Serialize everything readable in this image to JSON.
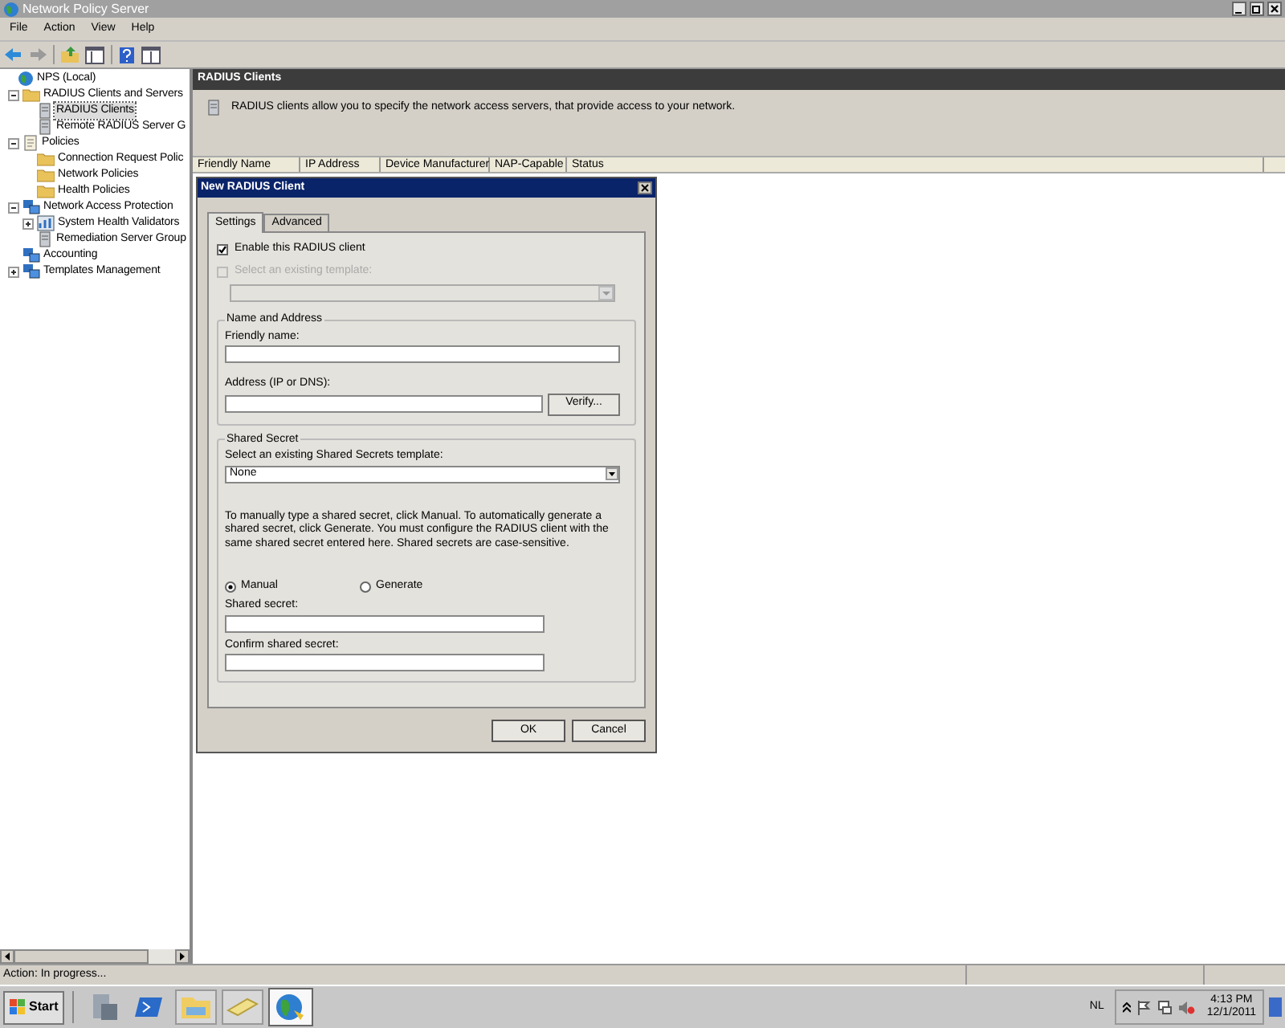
{
  "window": {
    "title": "Network Policy Server"
  },
  "menu": [
    "File",
    "Action",
    "View",
    "Help"
  ],
  "tree": [
    {
      "label": "NPS (Local)",
      "kind": "globe",
      "selected": false,
      "children": [
        {
          "label": "RADIUS Clients and Servers",
          "kind": "folder",
          "selected": false,
          "expanded": true,
          "children": [
            {
              "label": "RADIUS Clients",
              "kind": "server",
              "selected": true
            },
            {
              "label": "Remote RADIUS Server G",
              "kind": "server",
              "selected": false
            }
          ]
        },
        {
          "label": "Policies",
          "kind": "doc",
          "selected": false,
          "expanded": true,
          "children": [
            {
              "label": "Connection Request Polic",
              "kind": "folder",
              "selected": false
            },
            {
              "label": "Network Policies",
              "kind": "folder",
              "selected": false
            },
            {
              "label": "Health Policies",
              "kind": "folder",
              "selected": false
            }
          ]
        },
        {
          "label": "Network Access Protection",
          "kind": "network",
          "selected": false,
          "expanded": true,
          "children": [
            {
              "label": "System Health Validators",
              "kind": "chart",
              "selected": false,
              "expanded": false
            },
            {
              "label": "Remediation Server Group",
              "kind": "server",
              "selected": false
            }
          ]
        },
        {
          "label": "Accounting",
          "kind": "network",
          "selected": false
        },
        {
          "label": "Templates Management",
          "kind": "network",
          "selected": false,
          "expanded": false
        }
      ]
    }
  ],
  "panel": {
    "title": "RADIUS Clients",
    "description": "RADIUS clients allow you to specify the network access servers, that provide access to your network."
  },
  "table": {
    "columns": [
      "Friendly Name",
      "IP Address",
      "Device Manufacturer",
      "NAP-Capable",
      "Status"
    ]
  },
  "dialog": {
    "title": "New RADIUS Client",
    "tabs": [
      {
        "label": "Settings",
        "selected": true
      },
      {
        "label": "Advanced",
        "selected": false
      }
    ],
    "enable_checkbox": {
      "label": "Enable this RADIUS client",
      "checked": true,
      "disabled": false
    },
    "template_checkbox": {
      "label": "Select an existing template:",
      "checked": false,
      "disabled": true
    },
    "name_group": {
      "title": "Name and Address",
      "friendly_name_label": "Friendly name:",
      "address_label": "Address (IP or DNS):",
      "verify_button": "Verify..."
    },
    "secret_group": {
      "title": "Shared Secret",
      "template_label": "Select an existing Shared Secrets template:",
      "template_value": "None",
      "help": "To manually type a shared secret, click Manual. To automatically generate a shared secret, click Generate. You must configure the RADIUS client with the same shared secret entered here. Shared secrets are case-sensitive.",
      "radios": [
        {
          "label": "Manual",
          "selected": true
        },
        {
          "label": "Generate",
          "selected": false
        }
      ],
      "secret_label": "Shared secret:",
      "confirm_label": "Confirm shared secret:"
    },
    "buttons": [
      "OK",
      "Cancel"
    ]
  },
  "status_bar": "Action:  In progress...",
  "taskbar": {
    "start": "Start",
    "language": "NL",
    "time": "4:13 PM",
    "date": "12/1/2011"
  }
}
